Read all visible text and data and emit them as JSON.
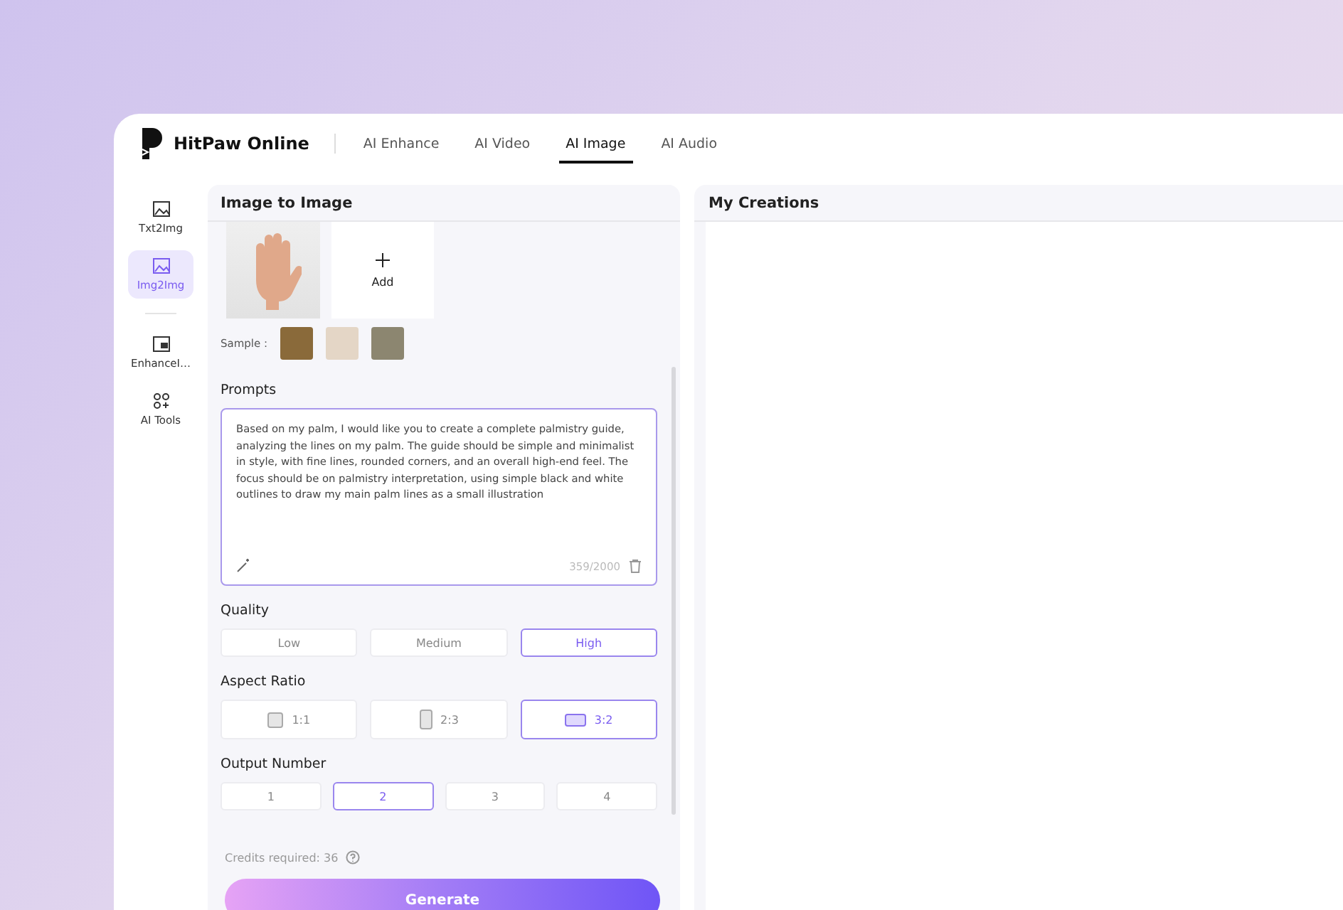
{
  "header": {
    "brand": "HitPaw Online",
    "nav": [
      {
        "label": "AI Enhance",
        "selected": false
      },
      {
        "label": "AI Video",
        "selected": false
      },
      {
        "label": "AI Image",
        "selected": true
      },
      {
        "label": "AI Audio",
        "selected": false
      }
    ]
  },
  "sidebar": {
    "items": [
      {
        "label": "Txt2Img",
        "selected": false
      },
      {
        "label": "Img2Img",
        "selected": true
      },
      {
        "label": "EnhanceI…",
        "selected": false
      },
      {
        "label": "AI Tools",
        "selected": false
      }
    ]
  },
  "panel": {
    "title": "Image to Image",
    "add_label": "Add",
    "sample_label": "Sample :",
    "prompts_label": "Prompts",
    "prompt_value": "Based on my palm, I would like you to create a complete palmistry guide, analyzing the lines on my palm. The guide should be simple and minimalist in style, with fine lines, rounded corners, and an overall high-end feel. The focus should be on palmistry interpretation, using simple black and white outlines to draw my main palm lines as a small illustration",
    "counter": "359/2000",
    "quality_label": "Quality",
    "quality": [
      {
        "label": "Low",
        "selected": false
      },
      {
        "label": "Medium",
        "selected": false
      },
      {
        "label": "High",
        "selected": true
      }
    ],
    "aspect_label": "Aspect Ratio",
    "aspect": [
      {
        "label": "1:1",
        "selected": false
      },
      {
        "label": "2:3",
        "selected": false
      },
      {
        "label": "3:2",
        "selected": true
      }
    ],
    "output_label": "Output Number",
    "output": [
      {
        "label": "1",
        "selected": false
      },
      {
        "label": "2",
        "selected": true
      },
      {
        "label": "3",
        "selected": false
      },
      {
        "label": "4",
        "selected": false
      }
    ],
    "credits": "Credits required: 36",
    "generate": "Generate"
  },
  "creations": {
    "title": "My Creations"
  }
}
